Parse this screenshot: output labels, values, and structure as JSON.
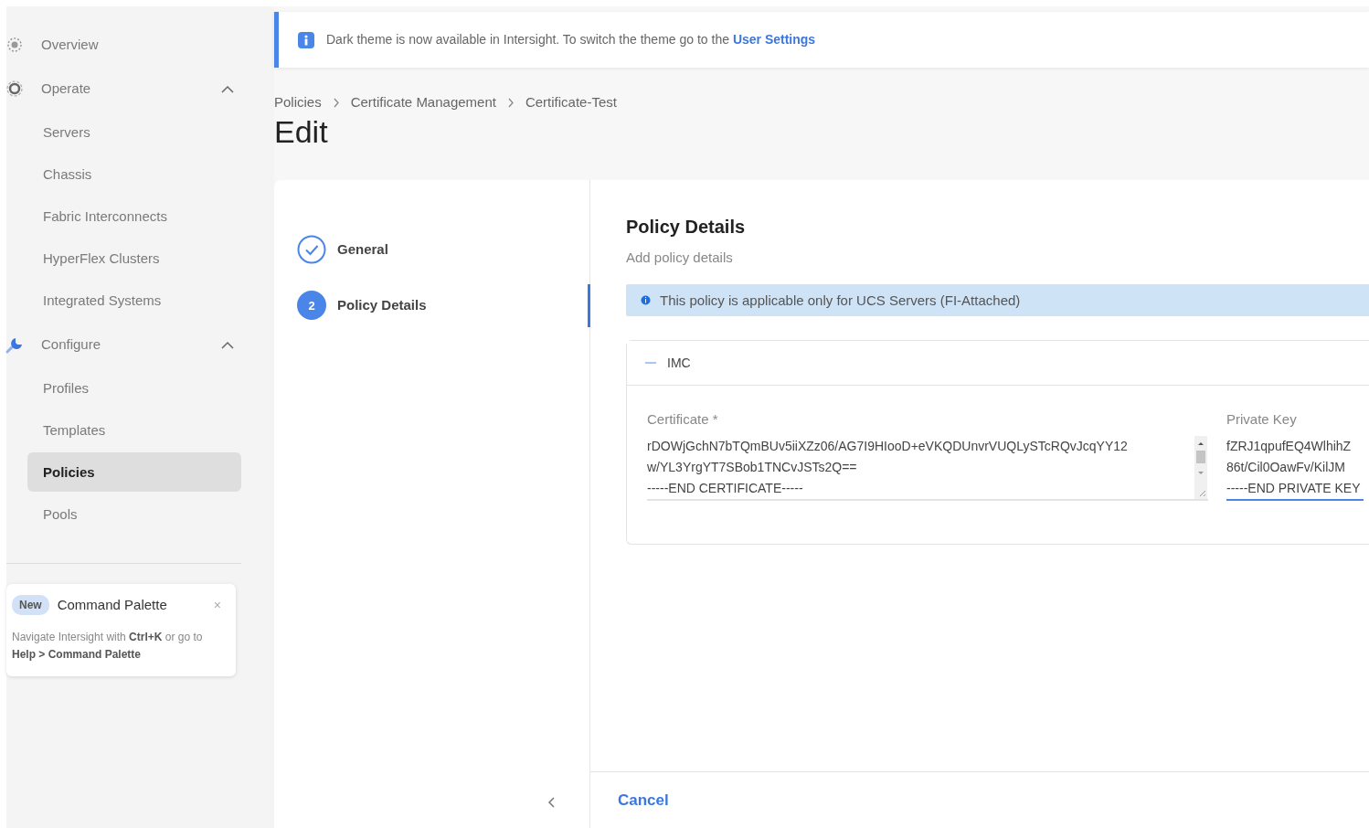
{
  "sidebar": {
    "sections": [
      {
        "label": "Overview",
        "selected": false
      },
      {
        "label": "Operate",
        "selected": false,
        "expanded": true,
        "children": [
          {
            "label": "Servers",
            "selected": false
          },
          {
            "label": "Chassis",
            "selected": false
          },
          {
            "label": "Fabric Interconnects",
            "selected": false
          },
          {
            "label": "HyperFlex Clusters",
            "selected": false
          },
          {
            "label": "Integrated Systems",
            "selected": false
          }
        ]
      },
      {
        "label": "Configure",
        "selected": false,
        "expanded": true,
        "children": [
          {
            "label": "Profiles",
            "selected": false
          },
          {
            "label": "Templates",
            "selected": false
          },
          {
            "label": "Policies",
            "selected": true
          },
          {
            "label": "Pools",
            "selected": false
          }
        ]
      }
    ]
  },
  "command_palette": {
    "badge": "New",
    "title": "Command Palette",
    "close": "×",
    "text": "Navigate Intersight with **Ctrl+K** or go to **Help > Command Palette**"
  },
  "banner": {
    "text": "Dark theme is now available in Intersight. To switch the theme go to the",
    "link": "User Settings"
  },
  "breadcrumbs": [
    "Policies",
    "Certificate Management",
    "Certificate-Test"
  ],
  "page_title": "Edit",
  "wizard": {
    "steps": [
      {
        "label": "General",
        "completed": true,
        "selected": false
      },
      {
        "label": "Policy Details",
        "completed": false,
        "number": "2",
        "selected": true
      }
    ]
  },
  "details": {
    "title": "Policy Details",
    "subtitle": "Add policy details",
    "info": "This policy is applicable only for UCS Servers (FI-Attached)",
    "section": {
      "title": "IMC",
      "expanded": true,
      "fields": [
        {
          "label": "Certificate *",
          "lines": [
            "rDOWjGchN7bTQmBUv5iiXZz06/AG7I9HIooD+eVKQDUnvrVUQLySTcRQvJcqYY12",
            "w/YL3YrgYT7SBob1TNCvJSTs2Q==",
            "-----END CERTIFICATE-----"
          ],
          "focused": false
        },
        {
          "label": "Private Key",
          "lines": [
            "fZRJ1qpufEQ4WlhihZ",
            "86t/Cil0OawFv/KilJM",
            "-----END PRIVATE KEY"
          ],
          "focused": true
        }
      ]
    }
  },
  "footer": {
    "cancel": "Cancel"
  }
}
